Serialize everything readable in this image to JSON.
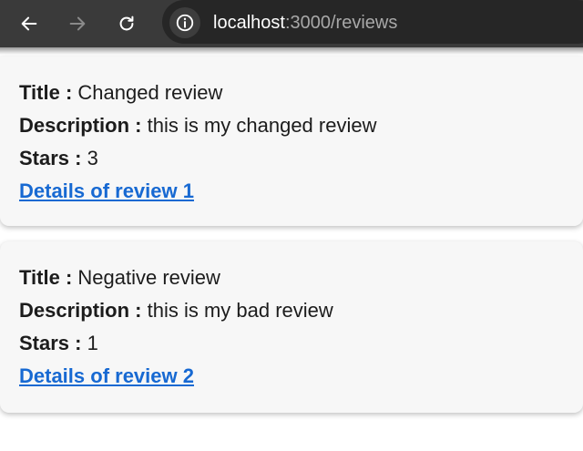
{
  "browser": {
    "url_host": "localhost",
    "url_path": ":3000/reviews",
    "colors": {
      "toolbar": "#3a3a3a",
      "omnibox": "#262626"
    }
  },
  "labels": {
    "title": "Title :",
    "description": "Description :",
    "stars": "Stars :"
  },
  "reviews": [
    {
      "title": "Changed review",
      "description": "this is my changed review",
      "stars": "3",
      "link": "Details of review 1"
    },
    {
      "title": "Negative review",
      "description": "this is my bad review",
      "stars": "1",
      "link": "Details of review 2"
    }
  ],
  "colors": {
    "link": "#1769d2",
    "card": "#f7f7f7"
  }
}
